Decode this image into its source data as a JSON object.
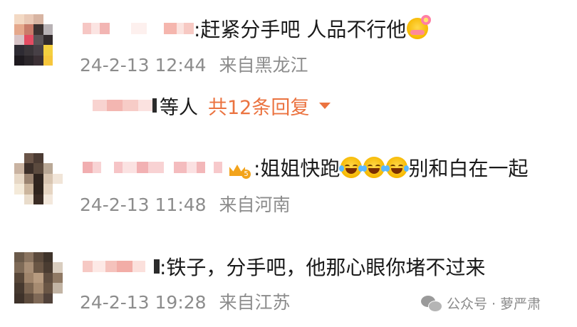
{
  "comments": [
    {
      "text": ":赶紧分手吧  人品不行他",
      "emoji": "face-with-flower-emoji",
      "time": "24-2-13 12:44",
      "location": "来自黑龙江"
    },
    {
      "text_prefix": ":姐姐快跑",
      "emoji_count": 3,
      "emoji": "tears-of-joy-emoji",
      "text_suffix": "别和白在一起",
      "badge": "5",
      "time": "24-2-13 11:48",
      "location": "来自河南"
    },
    {
      "text": ":铁子，分手吧，他那心眼你堵不过来",
      "time": "24-2-13 19:28",
      "location": "来自江苏"
    }
  ],
  "replies": {
    "who": "等人",
    "count": "共12条回复",
    "icon": "caret-down-icon"
  },
  "watermark": {
    "icon": "wechat-icon",
    "text": "公众号 · 萝严肃"
  },
  "colors": {
    "accent": "#eb7340",
    "meta": "#8c8c8c",
    "text": "#1a1a1a",
    "crown": "#f2a31b"
  }
}
